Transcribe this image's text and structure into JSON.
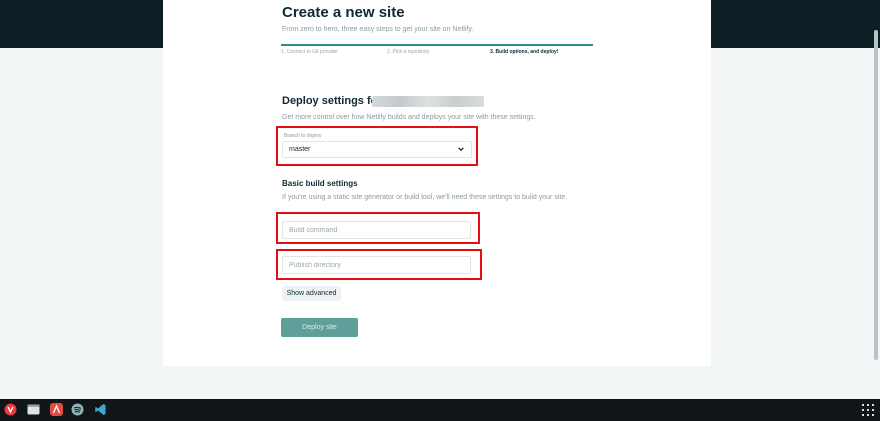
{
  "page": {
    "title": "Create a new site",
    "subtitle": "From zero to hero, three easy steps to get your site on Netlify."
  },
  "steps": [
    {
      "label": "1. Connect to Git provider"
    },
    {
      "label": "2. Pick a repository"
    },
    {
      "label": "3. Build options, and deploy!"
    }
  ],
  "deploy_settings": {
    "title": "Deploy settings for",
    "description": "Get more control over how Netlify builds and deploys your site with these settings.",
    "branch_label": "Branch to deploy",
    "branch_value": "master"
  },
  "basic_build": {
    "title": "Basic build settings",
    "description": "If you're using a static site generator or build tool, we'll need these settings to build your site.",
    "build_command_placeholder": "Build command",
    "publish_directory_placeholder": "Publish directory"
  },
  "buttons": {
    "show_advanced": "Show advanced",
    "deploy_site": "Deploy site"
  },
  "colors": {
    "accent": "#2b8c88",
    "highlight": "#e30d16",
    "header": "#0e1e25"
  },
  "taskbar": {
    "icons": [
      "vivaldi-icon",
      "window-icon",
      "app-icon",
      "spotify-icon",
      "vscode-icon",
      "apps-grid-icon"
    ]
  }
}
